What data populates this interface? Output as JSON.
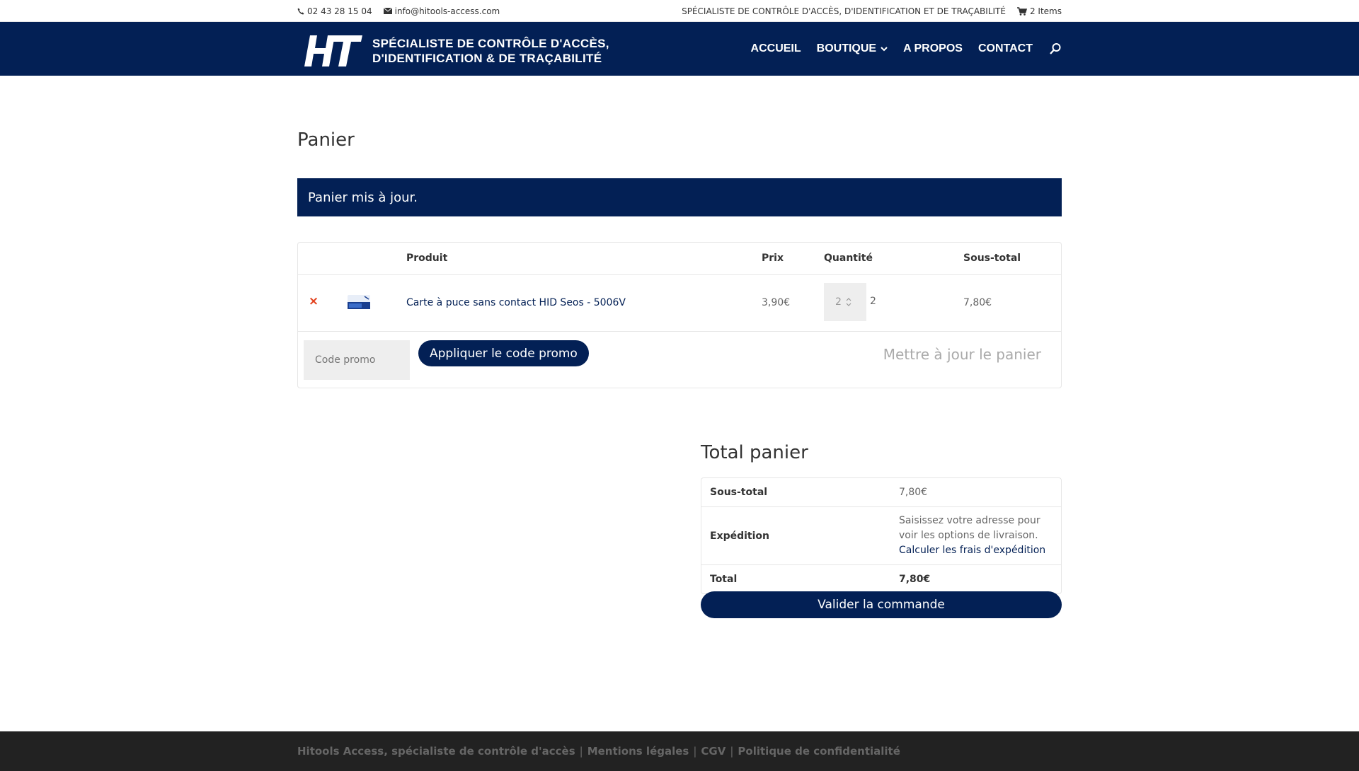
{
  "topbar": {
    "phone": "02 43 28 15 04",
    "email": "info@hitools-access.com",
    "tagline": "SPÉCIALISTE DE CONTRÔLE D'ACCÈS, D'IDENTIFICATION ET DE TRAÇABILITÉ",
    "cart_count": "2 Items"
  },
  "header": {
    "logo_line1": "SPÉCIALISTE DE CONTRÔLE D'ACCÈS,",
    "logo_line2": "D'IDENTIFICATION & DE TRAÇABILITÉ",
    "nav": [
      "ACCUEIL",
      "BOUTIQUE",
      "A PROPOS",
      "CONTACT"
    ]
  },
  "colors": {
    "brand": "#032055",
    "remove": "#e2401c",
    "footer": "#222222"
  },
  "page": {
    "title": "Panier",
    "notice": "Panier mis à jour."
  },
  "cart": {
    "headers": {
      "product": "Produit",
      "price": "Prix",
      "quantity": "Quantité",
      "subtotal": "Sous-total"
    },
    "items": [
      {
        "remove": "×",
        "name": "Carte à puce sans contact HID Seos - 5006V",
        "price": "3,90€",
        "quantity": "2",
        "subtotal": "7,80€"
      }
    ],
    "coupon_placeholder": "Code promo",
    "apply_coupon": "Appliquer le code promo",
    "update_cart": "Mettre à jour le panier"
  },
  "totals": {
    "title": "Total panier",
    "subtotal_label": "Sous-total",
    "subtotal_value": "7,80€",
    "shipping_label": "Expédition",
    "shipping_text": "Saisissez votre adresse pour voir les options de livraison.",
    "shipping_link": "Calculer les frais d'expédition",
    "total_label": "Total",
    "total_value": "7,80€",
    "checkout": "Valider la commande"
  },
  "footer": {
    "links": [
      "Hitools Access, spécialiste de contrôle d'accès",
      "Mentions légales",
      "CGV",
      "Politique de confidentialité"
    ]
  }
}
